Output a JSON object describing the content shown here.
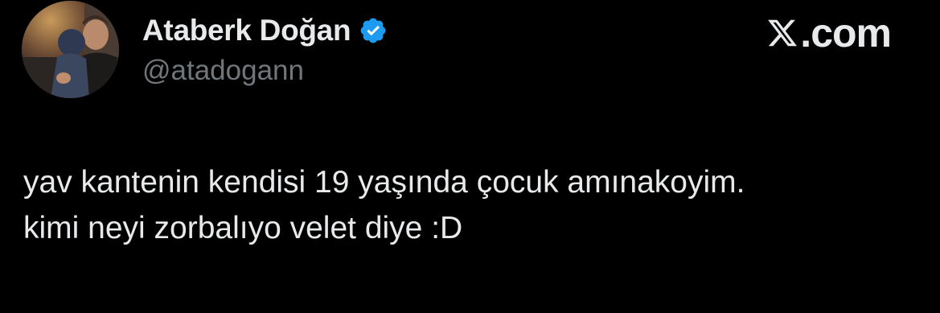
{
  "author": {
    "display_name": "Ataberk Doğan",
    "handle": "@atadogann",
    "verified_icon": "verified-badge-icon",
    "avatar_icon": "profile-photo"
  },
  "brand": {
    "label": ".com",
    "logo_icon": "x-logo-icon"
  },
  "tweet": {
    "lines": [
      "yav kantenin kendisi 19 yaşında çocuk amınakoyim.",
      "kimi neyi zorbalıyo velet diye :D"
    ]
  },
  "colors": {
    "background": "#000000",
    "text_primary": "#e7e9ea",
    "text_secondary": "#71767b",
    "verified_blue": "#1d9bf0"
  }
}
